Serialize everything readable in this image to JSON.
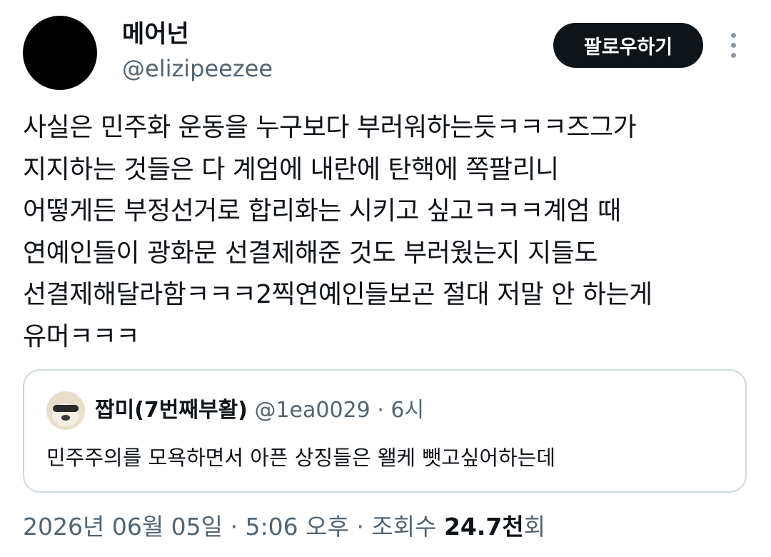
{
  "author": {
    "display_name": "메어넌",
    "handle": "@elizipeezee"
  },
  "follow_label": "팔로우하기",
  "tweet_text": "사실은 민주화 운동을 누구보다 부러워하는듯ㅋㅋㅋ즈그가\n지지하는 것들은 다 계엄에 내란에 탄핵에 쪽팔리니\n어떻게든 부정선거로 합리화는 시키고 싶고ㅋㅋㅋ계엄 때\n연예인들이 광화문 선결제해준 것도 부러웠는지 지들도\n선결제해달라함ㅋㅋㅋ2찍연예인들보곤 절대 저말 안 하는게\n유머ㅋㅋㅋ",
  "quote": {
    "display_name": "짭미(7번째부활)",
    "handle": "@1ea0029",
    "separator": "·",
    "time": "6시",
    "text": "민주주의를 모욕하면서 아픈 상징들은 왤케 뺏고싶어하는데"
  },
  "meta": {
    "date": "2026년 06월 05일",
    "sep1": "·",
    "time": "5:06 오후",
    "sep2": "·",
    "views_label": "조회수",
    "views_number": "24.7천",
    "views_suffix": "회"
  },
  "colors": {
    "text": "#0f1419",
    "secondary": "#536471",
    "border": "#cfd9de",
    "button_bg": "#0f1419"
  },
  "icons": {
    "more": "vertical-ellipsis-icon"
  }
}
